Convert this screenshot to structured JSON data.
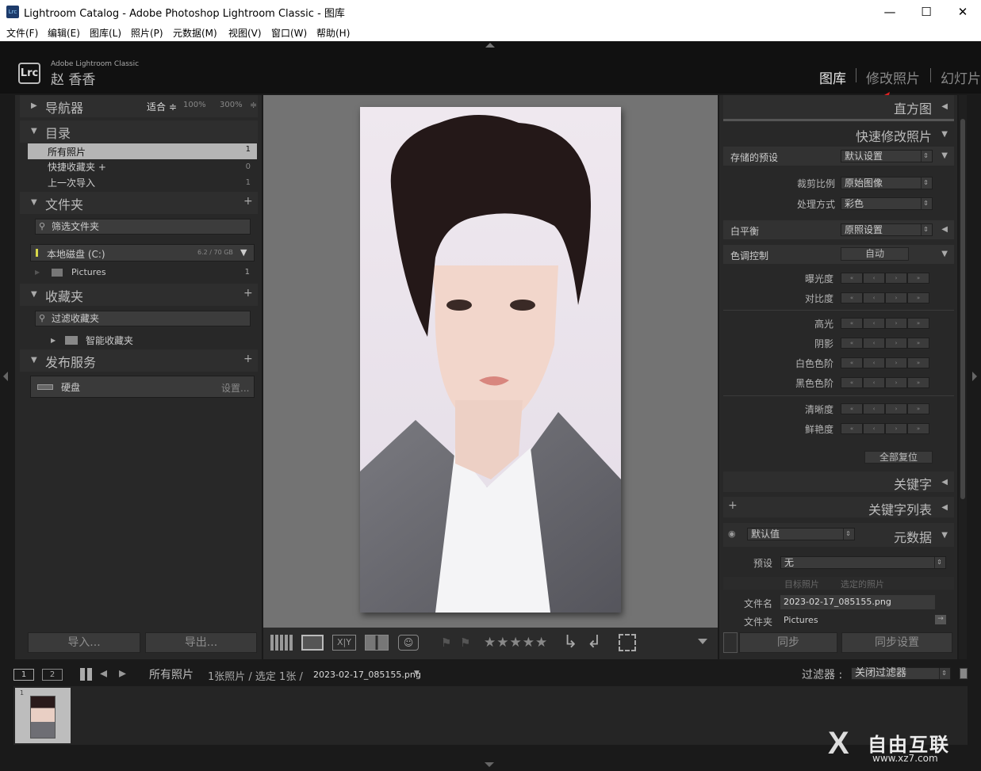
{
  "window": {
    "title": "Lightroom Catalog - Adobe Photoshop Lightroom Classic - 图库",
    "app_icon": "Lrc",
    "controls": {
      "minimize": "—",
      "maximize": "☐",
      "close": "✕"
    }
  },
  "menu": [
    "文件(F)",
    "编辑(E)",
    "图库(L)",
    "照片(P)",
    "元数据(M)",
    "视图(V)",
    "窗口(W)",
    "帮助(H)"
  ],
  "identity": {
    "logo": "Lrc",
    "product": "Adobe Lightroom Classic",
    "name": "赵 香香"
  },
  "modules": [
    "图库",
    "修改照片",
    "幻灯片"
  ],
  "left_panel": {
    "navigator": {
      "title": "导航器",
      "options": [
        "适合 ≑",
        "100%",
        "300%",
        "≑"
      ]
    },
    "catalog": {
      "title": "目录",
      "items": [
        {
          "label": "所有照片",
          "count": "1"
        },
        {
          "label": "快捷收藏夹 +",
          "count": "0"
        },
        {
          "label": "上一次导入",
          "count": "1"
        }
      ]
    },
    "folders": {
      "title": "文件夹",
      "filter_placeholder": "筛选文件夹",
      "disk": {
        "label": "本地磁盘 (C:)",
        "size": "6.2 / 70 GB"
      },
      "folder": {
        "label": "Pictures",
        "count": "1"
      }
    },
    "collections": {
      "title": "收藏夹",
      "filter_placeholder": "过滤收藏夹",
      "smart": "智能收藏夹"
    },
    "publish": {
      "title": "发布服务",
      "service": "硬盘",
      "settings": "设置..."
    },
    "import_label": "导入...",
    "export_label": "导出..."
  },
  "right_panel": {
    "histogram": "直方图",
    "quick_develop": {
      "title": "快速修改照片",
      "saved_preset_label": "存储的预设",
      "saved_preset_value": "默认设置",
      "crop_label": "裁剪比例",
      "crop_value": "原始图像",
      "treatment_label": "处理方式",
      "treatment_value": "彩色",
      "white_balance_label": "白平衡",
      "white_balance_value": "原照设置",
      "tone_label": "色调控制",
      "tone_auto": "自动",
      "sliders_a": [
        "曝光度",
        "对比度"
      ],
      "sliders_b": [
        "高光",
        "阴影",
        "白色色阶",
        "黑色色阶"
      ],
      "sliders_c": [
        "清晰度",
        "鲜艳度"
      ],
      "reset_all": "全部复位"
    },
    "keywords": "关键字",
    "keyword_list": "关键字列表",
    "metadata": {
      "title": "元数据",
      "default_value": "默认值",
      "preset_label": "预设",
      "preset_value": "无",
      "target_photo": "目标照片",
      "selected_photos": "选定的照片",
      "filename_label": "文件名",
      "filename_value": "2023-02-17_085155.png",
      "folder_label": "文件夹",
      "folder_value": "Pictures"
    },
    "sync_label": "同步",
    "sync_settings_label": "同步设置"
  },
  "toolbar": {
    "rating_stars": "★★★★★"
  },
  "filmstrip_bar": {
    "screen1": "1",
    "screen2": "2",
    "source": "所有照片",
    "info": "1张照片 / 选定 1张 /",
    "file": "2023-02-17_085155.png",
    "filter_label": "过滤器 :",
    "filter_value": "关闭过滤器"
  },
  "thumbnail": {
    "index": "1"
  },
  "watermark": {
    "text": "自由互联",
    "url": "www.xz7.com"
  },
  "colors": {
    "annotation_arrow": "#e02020",
    "accent_dark": "#1a1a1a"
  }
}
